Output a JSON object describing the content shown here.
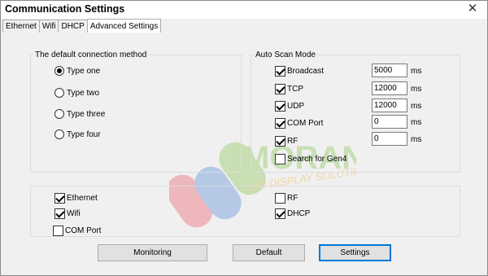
{
  "window": {
    "title": "Communication Settings",
    "close_icon": "close-icon"
  },
  "tabs": [
    {
      "label": "Ethernet",
      "active": false
    },
    {
      "label": "Wifi",
      "active": false
    },
    {
      "label": "DHCP",
      "active": false
    },
    {
      "label": "Advanced Settings",
      "active": true
    }
  ],
  "connection_method": {
    "title": "The default connection method",
    "options": [
      {
        "label": "Type one",
        "selected": true
      },
      {
        "label": "Type two",
        "selected": false
      },
      {
        "label": "Type three",
        "selected": false
      },
      {
        "label": "Type four",
        "selected": false
      }
    ]
  },
  "auto_scan": {
    "title": "Auto Scan Mode",
    "items": [
      {
        "label": "Broadcast",
        "checked": true,
        "value": "5000",
        "unit": "ms"
      },
      {
        "label": "TCP",
        "checked": true,
        "value": "12000",
        "unit": "ms"
      },
      {
        "label": "UDP",
        "checked": true,
        "value": "12000",
        "unit": "ms"
      },
      {
        "label": "COM Port",
        "checked": true,
        "value": "0",
        "unit": "ms"
      },
      {
        "label": "RF",
        "checked": true,
        "value": "0",
        "unit": "ms"
      },
      {
        "label": "Search for Gen4",
        "checked": false
      }
    ]
  },
  "interfaces": {
    "items": [
      {
        "label": "Ethernet",
        "checked": true
      },
      {
        "label": "Wifi",
        "checked": true
      },
      {
        "label": "COM Port",
        "checked": false
      },
      {
        "label": "RF",
        "checked": false
      },
      {
        "label": "DHCP",
        "checked": true
      }
    ]
  },
  "buttons": {
    "monitoring": "Monitoring",
    "default": "Default",
    "settings": "Settings"
  },
  "watermark": {
    "brand": "MORAN",
    "tagline": "LED DISPLAY SOLUTIONS",
    "colors": {
      "red": "#e8505b",
      "blue": "#4a7fd6",
      "green": "#7cc242",
      "orange": "#f5a623"
    }
  }
}
